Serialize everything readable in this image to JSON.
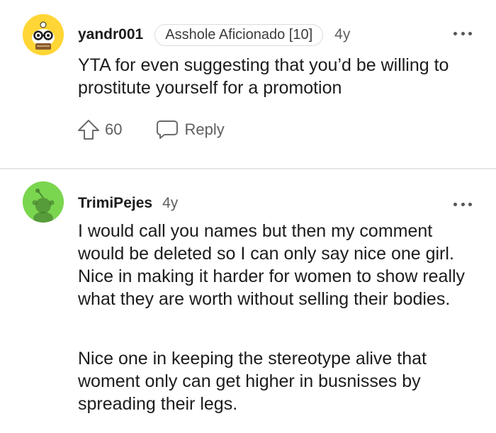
{
  "comments": [
    {
      "username": "yandr001",
      "flair": "Asshole Aficionado [10]",
      "age": "4y",
      "body": "YTA for even suggesting that you’d be willing to prostitute yourself for a promotion",
      "upvotes": "60",
      "reply_label": "Reply",
      "avatar_color": "#ffd635"
    },
    {
      "username": "TrimiPejes",
      "age": "4y",
      "paragraphs": [
        "I would call you names but then my comment would be deleted so I can only say nice one girl. Nice in making it harder for women to show really what they are worth without selling their bodies.",
        "Nice one in keeping the stereotype alive that woment only can get higher in busnisses by spreading their legs."
      ],
      "avatar_color": "#7bd64f"
    }
  ],
  "icons": {
    "upvote": "upvote-arrow-icon",
    "reply": "speech-bubble-icon",
    "more": "more-options-icon"
  }
}
